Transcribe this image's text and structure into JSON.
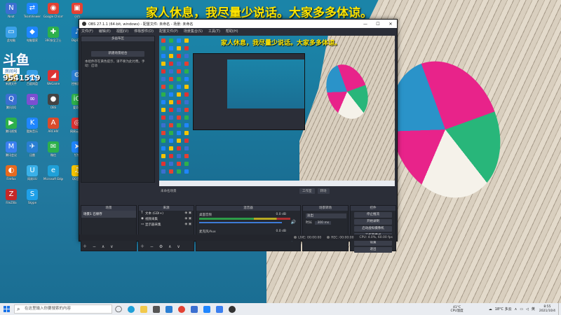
{
  "banner_text": "家人休息，我尽量少说话。大家多多体谅。",
  "douyu": {
    "logo": "斗鱼",
    "room_label": "房间号",
    "room_number": "9541519"
  },
  "desktop_icons": [
    {
      "label": "Neat",
      "color": "#3b6fd1",
      "glyph": "N"
    },
    {
      "label": "TeamViewer",
      "color": "#1f86ff",
      "glyph": "⇄"
    },
    {
      "label": "Google Chrome",
      "color": "#e34133",
      "glyph": "◉"
    },
    {
      "label": "小白",
      "color": "#e34133",
      "glyph": "▣"
    },
    {
      "label": "此电脑",
      "color": "#3aa0e8",
      "glyph": "▭"
    },
    {
      "label": "电脑管家",
      "color": "#1f86ff",
      "glyph": "◆"
    },
    {
      "label": "360安全卫士",
      "color": "#2db04b",
      "glyph": "✚"
    },
    {
      "label": "DigiCert",
      "color": "#1877c9",
      "glyph": "♪"
    },
    {
      "label": "新建文件",
      "color": "#d9b14a",
      "glyph": "▤"
    },
    {
      "label": "百度网盘",
      "color": "#3aa0e8",
      "glyph": "☁"
    },
    {
      "label": "WeGame",
      "color": "#d33",
      "glyph": "◢"
    },
    {
      "label": "控制面板",
      "color": "#2a7fd4",
      "glyph": "⚙"
    },
    {
      "label": "腾讯QQ",
      "color": "#3b6fd1",
      "glyph": "Q"
    },
    {
      "label": "VS",
      "color": "#7b4fd1",
      "glyph": "∞"
    },
    {
      "label": "OBS",
      "color": "#444",
      "glyph": "●"
    },
    {
      "label": "爱奇艺",
      "color": "#2db04b",
      "glyph": "iQ"
    },
    {
      "label": "腾讯视频",
      "color": "#2db04b",
      "glyph": "▶"
    },
    {
      "label": "酷狗音乐",
      "color": "#1f86ff",
      "glyph": "K"
    },
    {
      "label": "ARCHIV",
      "color": "#d94b2b",
      "glyph": "A"
    },
    {
      "label": "网易云音乐",
      "color": "#d33",
      "glyph": "◎"
    },
    {
      "label": "腾讯会议",
      "color": "#3a7ff0",
      "glyph": "M"
    },
    {
      "label": "迅雷",
      "color": "#2a7fd4",
      "glyph": "✈"
    },
    {
      "label": "微信",
      "color": "#2db04b",
      "glyph": "✉"
    },
    {
      "label": "钉钉",
      "color": "#1f86ff",
      "glyph": "➤"
    },
    {
      "label": "Firefox",
      "color": "#e66a1f",
      "glyph": "◐"
    },
    {
      "label": "网易UU",
      "color": "#3ab0e8",
      "glyph": "U"
    },
    {
      "label": "Microsoft Edge",
      "color": "#1fa0d8",
      "glyph": "e"
    },
    {
      "label": "QQ音乐",
      "color": "#f5c400",
      "glyph": "♫"
    },
    {
      "label": "FileZilla",
      "color": "#c62828",
      "glyph": "Z"
    },
    {
      "label": "Skype",
      "color": "#1fa0e8",
      "glyph": "S"
    }
  ],
  "obs": {
    "title": "OBS 27.1.1 (64-bit, windows) - 配置文件: 未命名 - 场景: 未命名",
    "menu": [
      "文件(F)",
      "编辑(E)",
      "视图(V)",
      "停靠部件(D)",
      "配置文件(P)",
      "场景集合(S)",
      "工具(T)",
      "帮助(H)"
    ],
    "scene_panel": {
      "header": "多画布区",
      "button": "新建场景组合",
      "message": "本组件存在黄色提示，请不要为此付费。手动：启动"
    },
    "preview": {
      "banner": "家人休息，我尽量少说话。大家多多体谅。",
      "status_left": "未命名场景",
      "studio_mode": "工作室",
      "mode_btn": "转场"
    },
    "scenes_dock": {
      "header": "场景",
      "items": [
        "场景1 已保存"
      ]
    },
    "sources_dock": {
      "header": "来源",
      "items": [
        {
          "icon": "T",
          "name": "文本 (GDI+)"
        },
        {
          "icon": "◉",
          "name": "视频采集"
        },
        {
          "icon": "▭",
          "name": "显示器采集"
        }
      ]
    },
    "mixer_dock": {
      "header": "混音器",
      "channels": [
        {
          "name": "桌面音频",
          "db": "0.0 dB"
        },
        {
          "name": "麦克风/Aux",
          "db": "0.0 dB"
        }
      ]
    },
    "transitions_dock": {
      "header": "场景转场",
      "transition": "淡出",
      "duration_label": "时长",
      "duration": "300 ms"
    },
    "controls_dock": {
      "header": "控件",
      "buttons": [
        "停止推流",
        "开始录制",
        "启动虚拟摄像机",
        "工作室模式",
        "设置",
        "退出"
      ]
    },
    "statusbar": {
      "live_label": "LIVE:",
      "live_time": "00:00:00",
      "rec_label": "REC:",
      "rec_time": "00:00:00",
      "cpu": "CPU: 4.0%, 60.00 fps"
    }
  },
  "taskbar": {
    "search_placeholder": "在这里输入你要搜索的内容",
    "weather_temp": "41°C",
    "weather_text": "CPU温度",
    "tray_temp": "18°C 多云",
    "ime": "英",
    "time": "8:55",
    "date": "2021/10/4"
  }
}
